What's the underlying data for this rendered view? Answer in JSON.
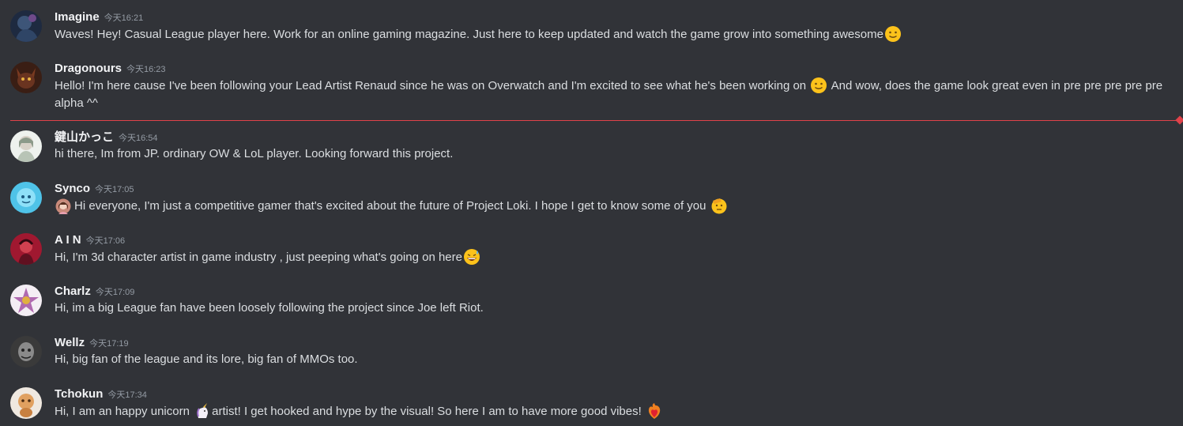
{
  "messages": [
    {
      "username": "Imagine",
      "timestamp": "今天16:21",
      "text_before": "Waves! Hey! Casual League player here. Work for an online gaming magazine. Just here to keep updated and watch the game grow into something awesome",
      "text_after": "",
      "emoji_before": "",
      "emoji_after": "slightly-smiling-face-emoji",
      "avatar_color": "#2a3a55"
    },
    {
      "username": "Dragonours",
      "timestamp": "今天16:23",
      "text_before": "Hello! I'm here cause I've been following your Lead Artist Renaud since he was on Overwatch and I'm excited to see what he's been working on",
      "text_after": "And wow, does the game look great even in pre pre pre pre pre alpha ^^",
      "emoji_middle": "slightly-smiling-face-emoji",
      "avatar_color": "#5a2e1e"
    },
    {
      "username": "鍵山かっこ",
      "timestamp": "今天16:54",
      "text_before": "hi there, Im from JP. ordinary OW & LoL player. Looking forward this project.",
      "avatar_color": "#e8efe8"
    },
    {
      "username": "Synco",
      "timestamp": "今天17:05",
      "text_before": "Hi everyone, I'm just a competitive gamer that's excited about the future of Project Loki. I hope I get to know some of you",
      "emoji_before": "custom-woman-emoji",
      "emoji_after": "saluting-face-emoji",
      "avatar_color": "#4fc3e8"
    },
    {
      "username": "A I N",
      "timestamp": "今天17:06",
      "text_before": "Hi, I'm 3d character artist in game industry , just peeping what's going on here",
      "emoji_after": "grinning-sweat-emoji",
      "avatar_color": "#b0203a"
    },
    {
      "username": "Charlz",
      "timestamp": "今天17:09",
      "text_before": "Hi, im a big League fan have been loosely following the project since Joe left Riot.",
      "avatar_color": "#f0e8f0"
    },
    {
      "username": "Wellz",
      "timestamp": "今天17:19",
      "text_before": "Hi, big fan of the league and its lore, big fan of MMOs too.",
      "avatar_color": "#4a4a4a"
    },
    {
      "username": "Tchokun",
      "timestamp": "今天17:34",
      "text_before": "Hi, I am an happy unicorn",
      "text_after": "artist! I get hooked and hype by the visual! So here I am to have more good vibes!",
      "emoji_middle": "unicorn-emoji",
      "emoji_after": "heart-on-fire-emoji",
      "avatar_color": "#e8e0d8"
    }
  ],
  "new_messages_divider_color": "#e0424a"
}
